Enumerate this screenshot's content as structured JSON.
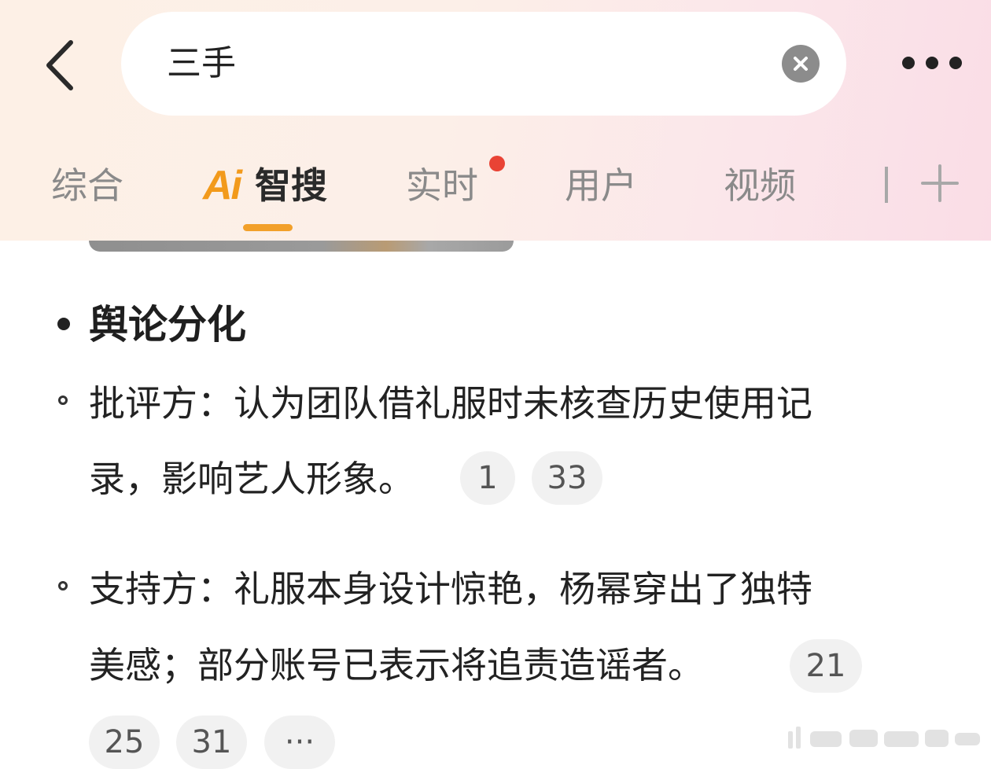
{
  "search": {
    "query": "三手"
  },
  "tabs": [
    {
      "label": "综合"
    },
    {
      "label": "智搜",
      "logo": "Ai",
      "active": true
    },
    {
      "label": "实时",
      "has_red_dot": true
    },
    {
      "label": "用户"
    },
    {
      "label": "视频"
    }
  ],
  "content": {
    "heading": "舆论分化",
    "items": [
      {
        "lines": [
          "批评方：认为团队借礼服时未核查历史使用记",
          "录，影响艺人形象。"
        ],
        "citations": [
          "1",
          "33"
        ]
      },
      {
        "lines": [
          "支持方：礼服本身设计惊艳，杨幂穿出了独特",
          "美感；部分账号已表示将追责造谣者。"
        ],
        "citations": [
          "21",
          "25",
          "31",
          "···"
        ]
      }
    ]
  },
  "icons": {
    "back": "chevron-left-icon",
    "clear": "close-circle-icon",
    "more": "more-dots-icon",
    "add_tab": "plus-icon"
  },
  "colors": {
    "accent": "#f2a02a",
    "red_dot": "#e94335",
    "tab_inactive": "#8a8a8a"
  }
}
